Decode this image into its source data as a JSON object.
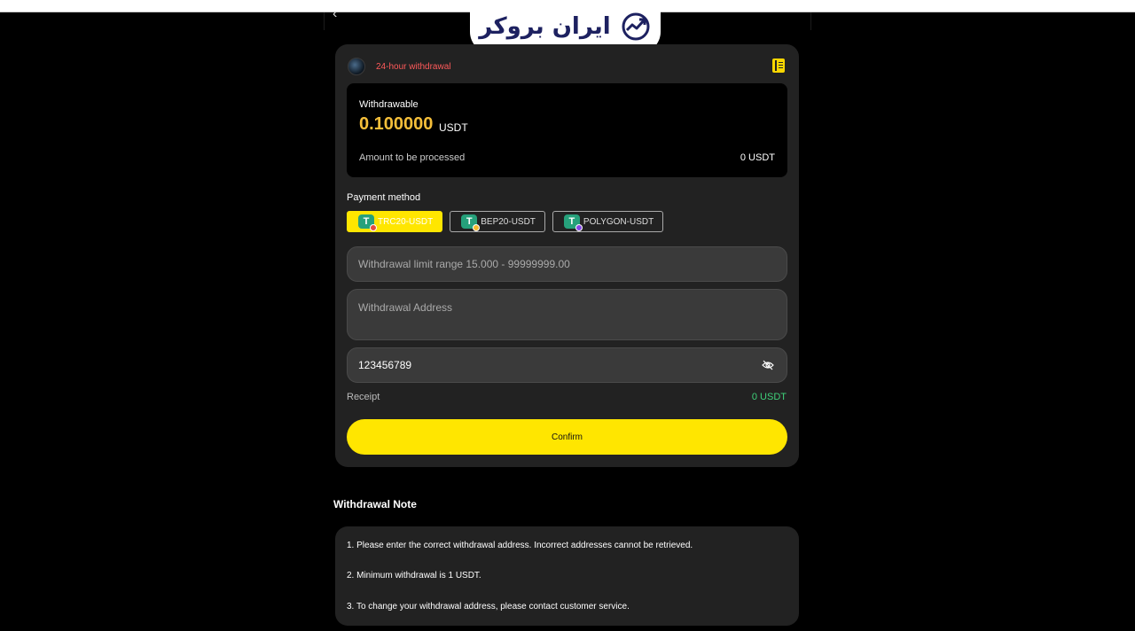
{
  "logo": {
    "text": "ایران بروکر"
  },
  "header": {
    "badge": "24-hour withdrawal"
  },
  "balance": {
    "withdrawable_label": "Withdrawable",
    "withdrawable_amount": "0.100000",
    "withdrawable_unit": "USDT",
    "processed_label": "Amount to be processed",
    "processed_value": "0 USDT"
  },
  "payment": {
    "label": "Payment method",
    "methods": [
      {
        "label": "TRC20-USDT",
        "selected": true,
        "icon": "tether-trc20-icon"
      },
      {
        "label": "BEP20-USDT",
        "selected": false,
        "icon": "tether-bep20-icon"
      },
      {
        "label": "POLYGON-USDT",
        "selected": false,
        "icon": "tether-polygon-icon"
      }
    ]
  },
  "form": {
    "amount_placeholder": "Withdrawal limit range 15.000 - 99999999.00",
    "address_placeholder": "Withdrawal Address",
    "password_value": "123456789"
  },
  "receipt": {
    "label": "Receipt",
    "value": "0 USDT"
  },
  "confirm": {
    "label": "Confirm"
  },
  "note": {
    "title": "Withdrawal Note",
    "lines": [
      "1. Please enter the correct withdrawal address. Incorrect addresses cannot be retrieved.",
      "2. Minimum withdrawal is 1 USDT.",
      "3. To change your withdrawal address, please contact customer service."
    ]
  },
  "colors": {
    "accent": "#ffe600",
    "amount": "#f5bf3a",
    "badge": "#ff5a5a",
    "receipt": "#3fd17a",
    "tether": "#26a17b"
  }
}
